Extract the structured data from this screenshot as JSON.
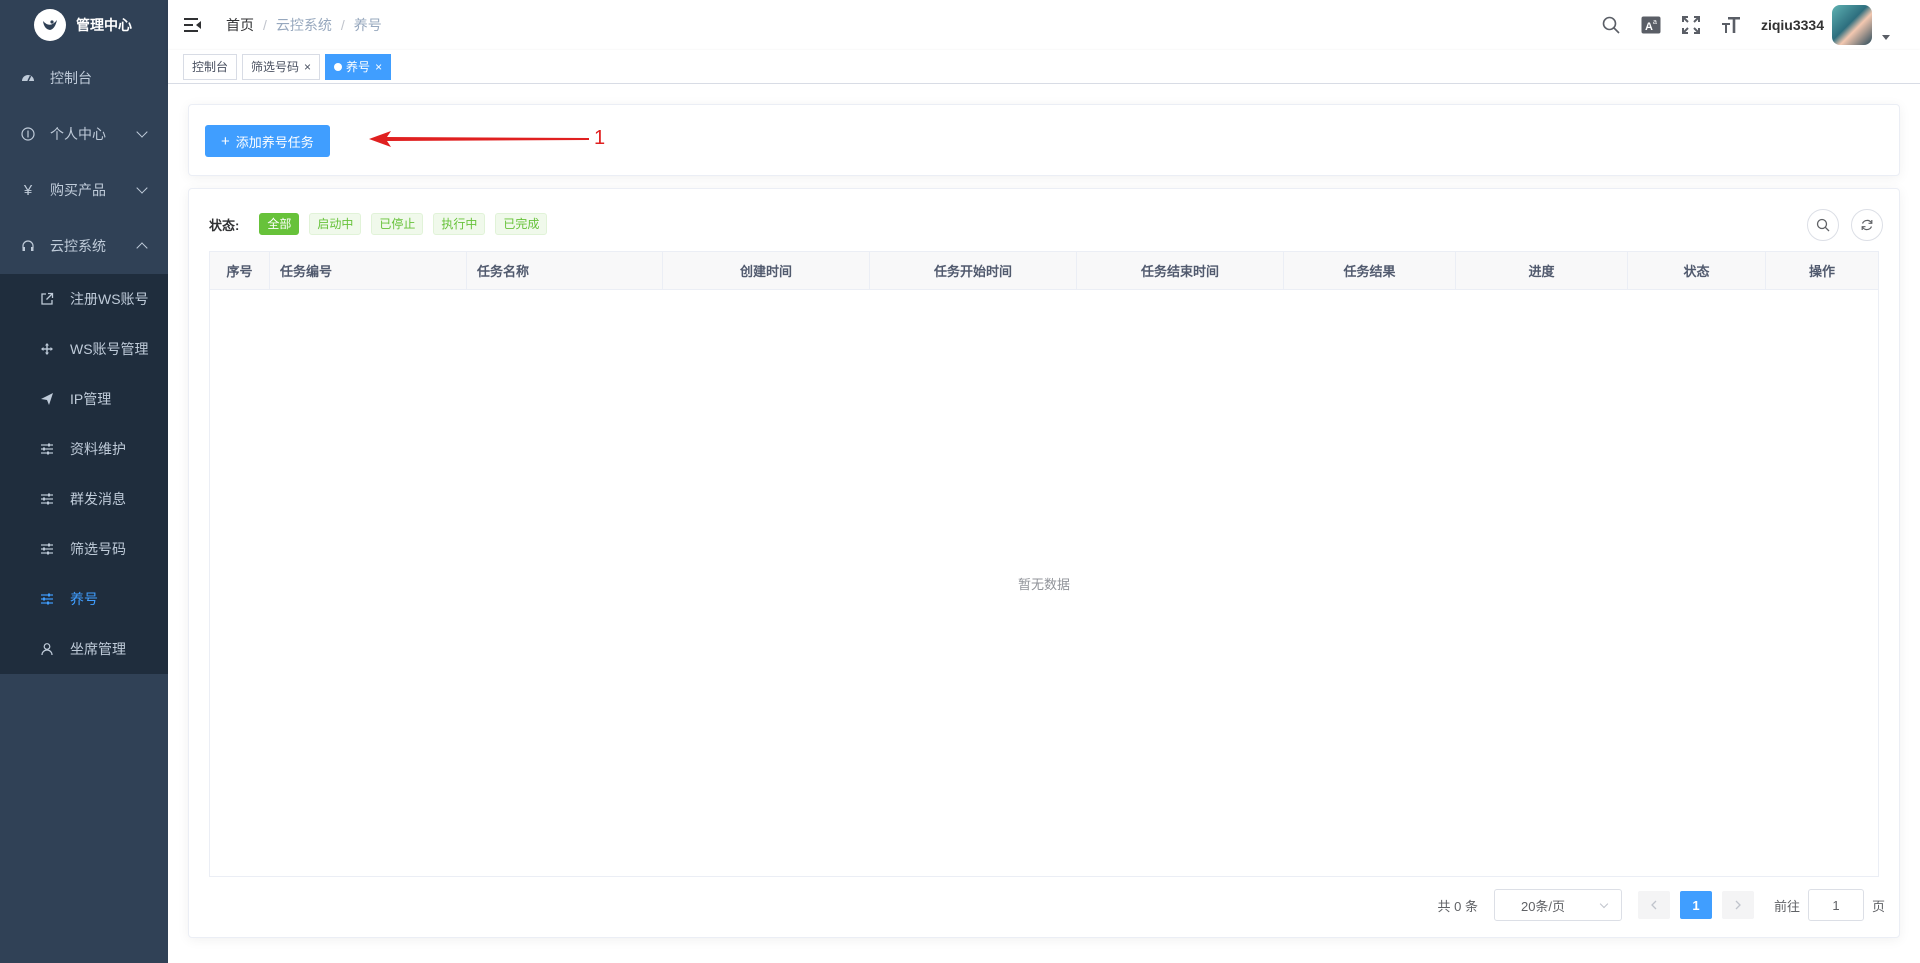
{
  "sidebar": {
    "title": "管理中心",
    "menu": [
      {
        "label": "控制台",
        "icon": "dashboard-icon"
      },
      {
        "label": "个人中心",
        "icon": "user-circle-icon"
      },
      {
        "label": "购买产品",
        "icon": "yen-icon"
      },
      {
        "label": "云控系统",
        "icon": "headset-icon"
      }
    ],
    "submenu": [
      {
        "label": "注册WS账号",
        "icon": "external-link-icon"
      },
      {
        "label": "WS账号管理",
        "icon": "move-icon"
      },
      {
        "label": "IP管理",
        "icon": "paper-plane-icon"
      },
      {
        "label": "资料维护",
        "icon": "sliders-icon"
      },
      {
        "label": "群发消息",
        "icon": "sliders-icon"
      },
      {
        "label": "筛选号码",
        "icon": "sliders-icon"
      },
      {
        "label": "养号",
        "icon": "sliders-icon"
      },
      {
        "label": "坐席管理",
        "icon": "user-icon"
      }
    ]
  },
  "navbar": {
    "breadcrumb": [
      "首页",
      "云控系统",
      "养号"
    ],
    "username": "ziqiu3334"
  },
  "tags": [
    {
      "label": "控制台"
    },
    {
      "label": "筛选号码"
    },
    {
      "label": "养号"
    }
  ],
  "toolbar": {
    "add_label": "添加养号任务",
    "annotation": "1"
  },
  "filter": {
    "label": "状态:",
    "options": [
      "全部",
      "启动中",
      "已停止",
      "执行中",
      "已完成"
    ]
  },
  "table": {
    "columns": [
      "序号",
      "任务编号",
      "任务名称",
      "创建时间",
      "任务开始时间",
      "任务结束时间",
      "任务结果",
      "进度",
      "状态",
      "操作"
    ],
    "empty_text": "暂无数据"
  },
  "pagination": {
    "total": "共 0 条",
    "page_size": "20条/页",
    "current": "1",
    "goto_label": "前往",
    "goto_value": "1",
    "page_suffix": "页"
  },
  "colors": {
    "sidebar_bg": "#304156",
    "primary": "#409eff",
    "success": "#67c23a"
  }
}
